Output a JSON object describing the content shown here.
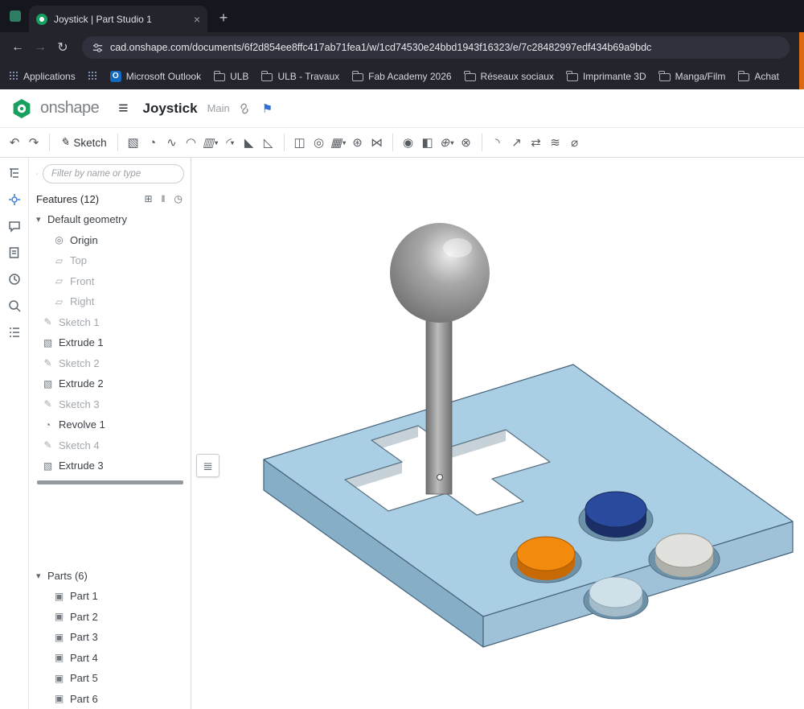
{
  "browser": {
    "tab_title": "Joystick | Part Studio 1",
    "close_glyph": "×",
    "new_tab_glyph": "+",
    "back_glyph": "←",
    "forward_glyph": "→",
    "reload_glyph": "↻",
    "url": "cad.onshape.com/documents/6f2d854ee8ffc417ab71fea1/w/1cd74530e24bbd1943f16323/e/7c28482997edf434b69a9bdc",
    "bookmarks": [
      {
        "label": "Applications"
      },
      {
        "label": ""
      },
      {
        "label": "Microsoft Outlook"
      },
      {
        "label": "ULB"
      },
      {
        "label": "ULB - Travaux"
      },
      {
        "label": "Fab Academy 2026"
      },
      {
        "label": "Réseaux sociaux"
      },
      {
        "label": "Imprimante 3D"
      },
      {
        "label": "Manga/Film"
      },
      {
        "label": "Achat"
      }
    ]
  },
  "onshape": {
    "brand": "onshape",
    "hamburger_glyph": "≡",
    "document_title": "Joystick",
    "workspace_name": "Main",
    "education_flag_glyph": "⚑"
  },
  "cad_toolbar": {
    "undo_glyph": "↶",
    "redo_glyph": "↷",
    "sketch_glyph": "✎",
    "sketch_label": "Sketch",
    "caret_glyph": "▾",
    "items": [
      {
        "name": "extrude",
        "glyph": "▧"
      },
      {
        "name": "revolve",
        "glyph": "◔"
      },
      {
        "name": "sweep",
        "glyph": "∿"
      },
      {
        "name": "loft",
        "glyph": "◠"
      },
      {
        "name": "thicken",
        "glyph": "▥"
      },
      {
        "name": "fillet",
        "glyph": "◜"
      },
      {
        "name": "chamfer",
        "glyph": "◣"
      },
      {
        "name": "draft",
        "glyph": "◺"
      },
      {
        "name": "shell",
        "glyph": "◫"
      },
      {
        "name": "hole",
        "glyph": "◎"
      },
      {
        "name": "linear-pattern",
        "glyph": "▦"
      },
      {
        "name": "circular-pattern",
        "glyph": "⊛"
      },
      {
        "name": "mirror",
        "glyph": "⋈"
      },
      {
        "name": "boolean",
        "glyph": "◉"
      },
      {
        "name": "split",
        "glyph": "◧"
      },
      {
        "name": "transform",
        "glyph": "⊕"
      },
      {
        "name": "delete-part",
        "glyph": "⊗"
      },
      {
        "name": "modify-fillet",
        "glyph": "◝"
      },
      {
        "name": "move-face",
        "glyph": "↗"
      },
      {
        "name": "replace-face",
        "glyph": "⇄"
      },
      {
        "name": "offset-surface",
        "glyph": "≋"
      },
      {
        "name": "measure",
        "glyph": "⌀"
      }
    ]
  },
  "feature_panel": {
    "filter_placeholder": "Filter by name or type",
    "features_header": "Features (12)",
    "chevron_glyph": "▾",
    "header_icons": {
      "create_folder": "⊞",
      "suppress": "‖",
      "stopwatch": "◷"
    },
    "tree": [
      {
        "label": "Default geometry",
        "glyph": ""
      },
      {
        "label": "Origin",
        "glyph": "◎"
      },
      {
        "label": "Top",
        "glyph": "▱"
      },
      {
        "label": "Front",
        "glyph": "▱"
      },
      {
        "label": "Right",
        "glyph": "▱"
      },
      {
        "label": "Sketch 1",
        "glyph": "✎"
      },
      {
        "label": "Extrude 1",
        "glyph": "▧"
      },
      {
        "label": "Sketch 2",
        "glyph": "✎"
      },
      {
        "label": "Extrude 2",
        "glyph": "▧"
      },
      {
        "label": "Sketch 3",
        "glyph": "✎"
      },
      {
        "label": "Revolve 1",
        "glyph": "◔"
      },
      {
        "label": "Sketch 4",
        "glyph": "✎"
      },
      {
        "label": "Extrude 3",
        "glyph": "▧"
      }
    ],
    "parts_header": "Parts (6)",
    "part_glyph": "▣",
    "parts": [
      {
        "label": "Part 1"
      },
      {
        "label": "Part 2"
      },
      {
        "label": "Part 3"
      },
      {
        "label": "Part 4"
      },
      {
        "label": "Part 5"
      },
      {
        "label": "Part 6"
      }
    ]
  },
  "viewport": {
    "flyout_glyph": "≣"
  },
  "model": {
    "colors": {
      "plate_top": "#aacfe4",
      "plate_left": "#86aec7",
      "plate_right": "#9fc2d8",
      "hole_wall": "#c6d1d8",
      "recess": "#6d92a8",
      "shaft_dark": "#6f6f6f",
      "shaft_light": "#bcbcbc",
      "ball_light": "#ececec",
      "ball_mid": "#a8a8a8",
      "ball_dark": "#6b6b6b",
      "button_blue_top": "#2a4a9e",
      "button_blue_side": "#1b2f66",
      "button_orange_top": "#f28a0d",
      "button_orange_side": "#c76a05",
      "button_white_top": "#e1e1dd",
      "button_white_side": "#b0b0aa",
      "button_lightblue_top": "#cfe0e9",
      "button_lightblue_side": "#a4bcc9"
    }
  }
}
